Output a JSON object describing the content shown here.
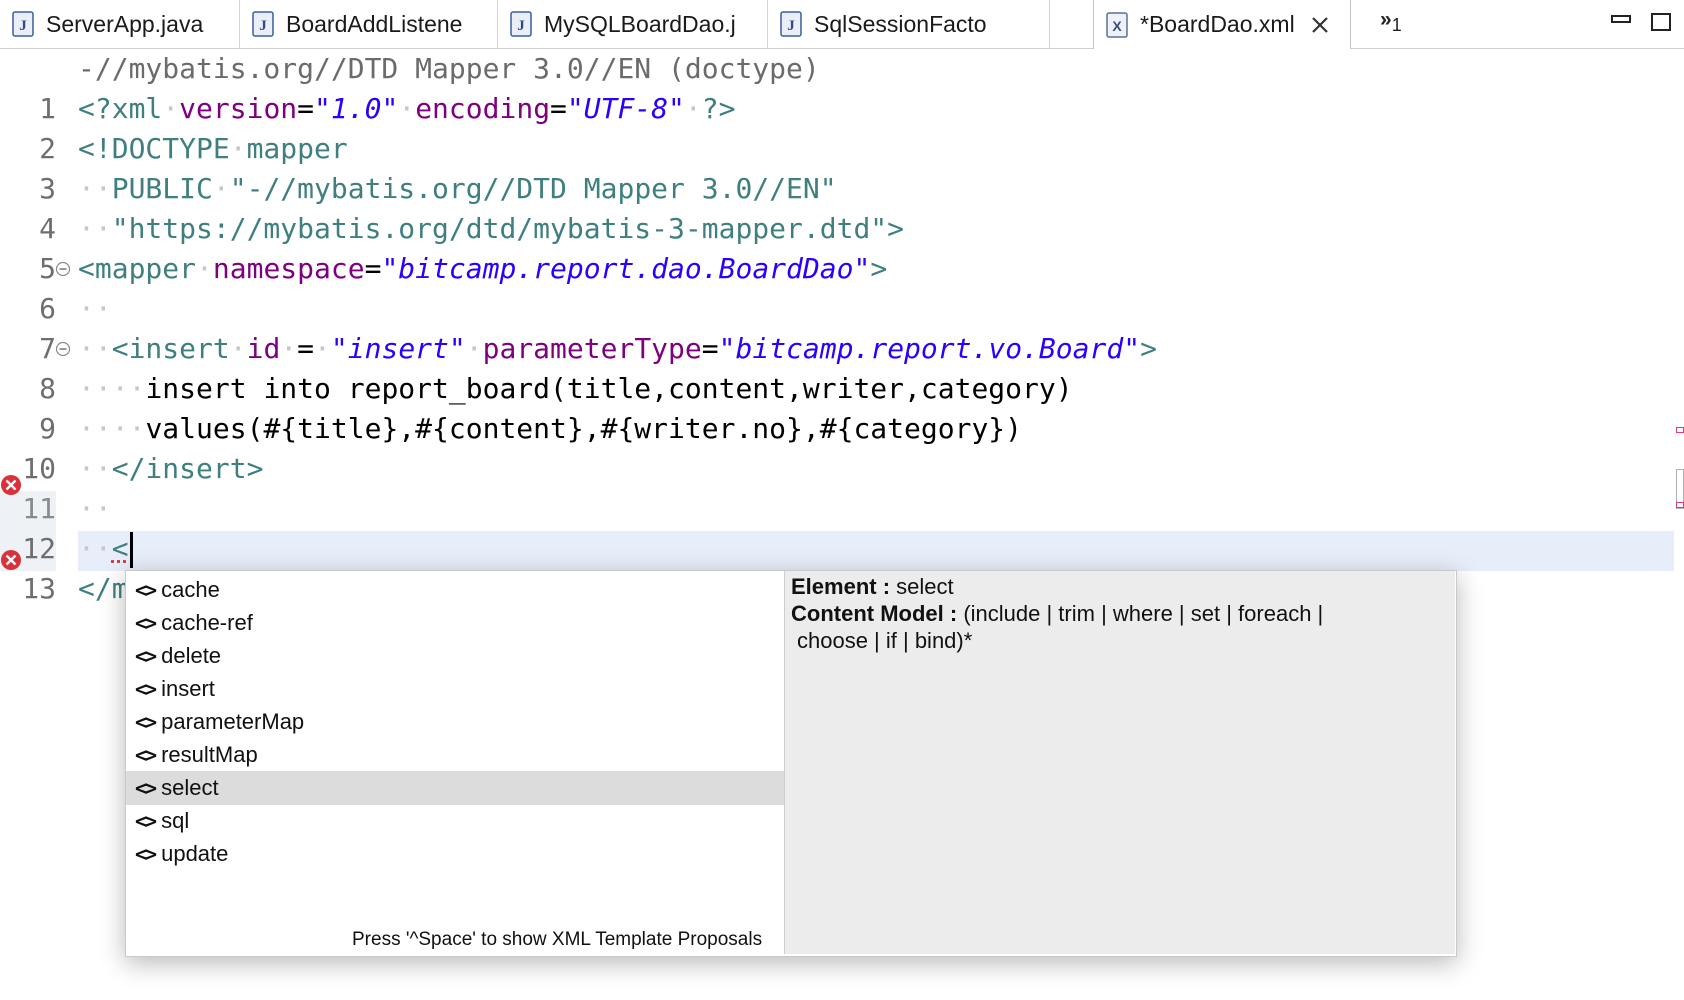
{
  "tabs": [
    {
      "label": "ServerApp.java",
      "icon": "java-file-icon"
    },
    {
      "label": "BoardAddListene",
      "icon": "java-file-icon"
    },
    {
      "label": "MySQLBoardDao.j",
      "icon": "java-file-icon"
    },
    {
      "label": "SqlSessionFacto",
      "icon": "java-file-icon"
    },
    {
      "label": "*BoardDao.xml",
      "icon": "xml-file-icon",
      "active": true
    }
  ],
  "overflow": {
    "symbol": "»",
    "count": "1"
  },
  "editor": {
    "header": "-//mybatis.org//DTD Mapper 3.0//EN (doctype)",
    "line_numbers": [
      "1",
      "2",
      "3",
      "4",
      "5",
      "6",
      "7",
      "8",
      "9",
      "10",
      "11",
      "12",
      "13"
    ],
    "lines": {
      "l1": {
        "open": "<?xml",
        "a1": "version",
        "eq1": "=",
        "v1": "\"1.0\"",
        "a2": "encoding",
        "eq2": "=",
        "v2": "\"UTF-8\"",
        "close": "?>"
      },
      "l2": {
        "open": "<!DOCTYPE",
        "name": "mapper"
      },
      "l3": {
        "kw": "PUBLIC",
        "pub": "\"-//mybatis.org//DTD Mapper 3.0//EN\""
      },
      "l4": {
        "sys": "\"https://mybatis.org/dtd/mybatis-3-mapper.dtd\"",
        "close": ">"
      },
      "l5": {
        "open": "<mapper",
        "a1": "namespace",
        "eq": "=",
        "v1": "\"bitcamp.report.dao.BoardDao\"",
        "close": ">"
      },
      "l7": {
        "open": "<insert",
        "a1": "id",
        "eq1": "=",
        "v1": "\"insert\"",
        "a2": "parameterType",
        "eq2": "=",
        "v2": "\"bitcamp.report.vo.Board\"",
        "close": ">"
      },
      "l8": {
        "text": "insert into report_board(title,content,writer,category)"
      },
      "l9": {
        "text": "values(#{title},#{content},#{writer.no},#{category})"
      },
      "l10": {
        "close": "</insert>"
      },
      "l12": {
        "text": "<"
      },
      "l13": {
        "text": "</m"
      }
    }
  },
  "popup": {
    "items": [
      "cache",
      "cache-ref",
      "delete",
      "insert",
      "parameterMap",
      "resultMap",
      "select",
      "sql",
      "update"
    ],
    "selected": "select",
    "hint": "Press '^Space' to show XML Template Proposals",
    "info": {
      "element_label": "Element :",
      "element_value": "select",
      "content_label": "Content Model :",
      "content_value_1": "(include | trim | where | set | foreach |",
      "content_value_2": "choose | if | bind)*"
    }
  },
  "colors": {
    "tag": "#3f7f7f",
    "attr": "#7f007f",
    "value": "#2a00ff",
    "error": "#d9303a",
    "selection": "#dcdcdc"
  }
}
